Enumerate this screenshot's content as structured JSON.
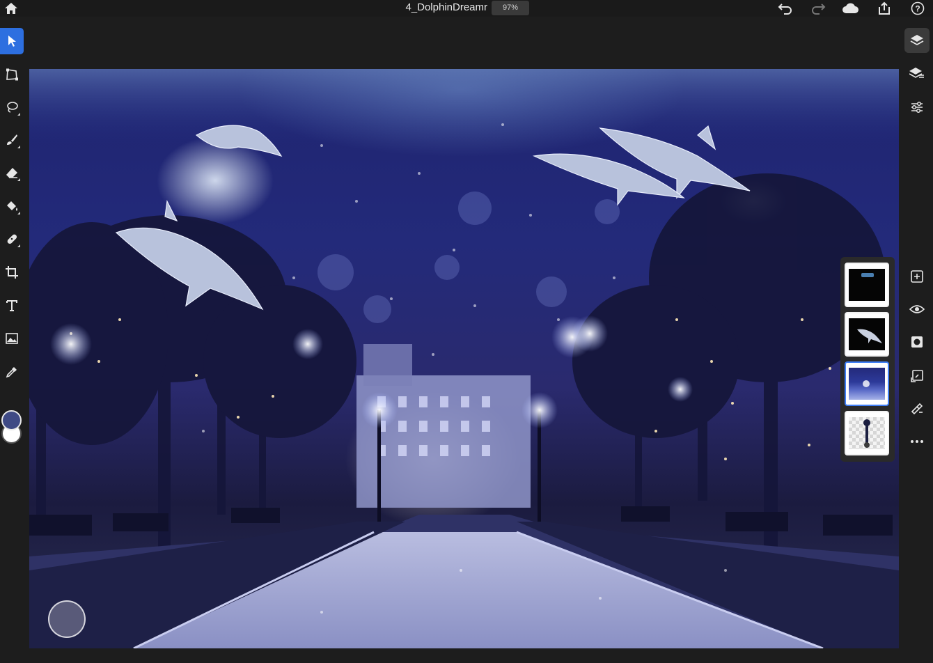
{
  "document": {
    "title": "4_DolphinDreamr",
    "zoom": "97%"
  },
  "topbar": {
    "icons": [
      "home-icon",
      "undo-icon",
      "redo-icon",
      "cloud-icon",
      "share-icon",
      "help-icon"
    ]
  },
  "left_toolbar": {
    "tools": [
      {
        "name": "select-tool",
        "icon": "arrow-icon",
        "active": true
      },
      {
        "name": "transform-tool",
        "icon": "transform-icon",
        "active": false
      },
      {
        "name": "lasso-tool",
        "icon": "lasso-icon",
        "active": false
      },
      {
        "name": "brush-tool",
        "icon": "brush-icon",
        "active": false
      },
      {
        "name": "eraser-tool",
        "icon": "eraser-icon",
        "active": false
      },
      {
        "name": "fill-tool",
        "icon": "paint-bucket-icon",
        "active": false
      },
      {
        "name": "healing-tool",
        "icon": "bandage-icon",
        "active": false
      },
      {
        "name": "crop-tool",
        "icon": "crop-icon",
        "active": false
      },
      {
        "name": "type-tool",
        "icon": "type-icon",
        "active": false
      },
      {
        "name": "image-tool",
        "icon": "image-icon",
        "active": false
      },
      {
        "name": "eyedropper-tool",
        "icon": "eyedropper-icon",
        "active": false
      }
    ],
    "foreground_color": "#3f4a85",
    "background_color": "#ffffff"
  },
  "right_toolbar": {
    "tools": [
      "layers-icon",
      "layer-properties-icon",
      "adjustments-icon",
      "add-layer-icon",
      "visibility-icon",
      "mask-icon",
      "transform-layer-icon",
      "fx-icon",
      "more-icon"
    ]
  },
  "layers": [
    {
      "name": "layer-water-surface",
      "selected": false
    },
    {
      "name": "layer-dolphin",
      "selected": false
    },
    {
      "name": "layer-night-park",
      "selected": true
    },
    {
      "name": "layer-lamp-post",
      "selected": false
    }
  ],
  "colors": {
    "accent": "#2d6fe0",
    "selected_layer": "#3f7ef5"
  }
}
